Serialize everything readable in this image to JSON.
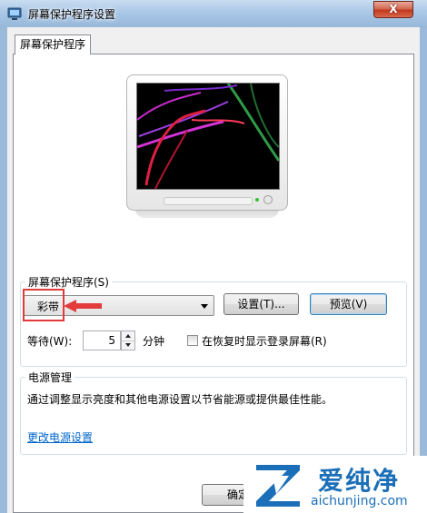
{
  "window": {
    "title": "屏幕保护程序设置",
    "close_label": "X"
  },
  "tab": {
    "label": "屏幕保护程序"
  },
  "screensaver": {
    "group_label": "屏幕保护程序(S)",
    "selected_value": "彩带",
    "settings_button": "设置(T)...",
    "preview_button": "预览(V)",
    "wait_label": "等待(W):",
    "wait_value": "5",
    "minutes_label": "分钟",
    "resume_checkbox_label": "在恢复时显示登录屏幕(R)",
    "resume_checked": false
  },
  "power": {
    "group_label": "电源管理",
    "description": "通过调整显示亮度和其他电源设置以节省能源或提供最佳性能。",
    "link_label": "更改电源设置"
  },
  "footer": {
    "ok_button": "确定"
  },
  "annotation": {
    "highlight_color": "#e23b3b"
  },
  "watermark": {
    "brand": "爱纯净",
    "url": "aichunjing.com",
    "color": "#1b6fb8"
  }
}
